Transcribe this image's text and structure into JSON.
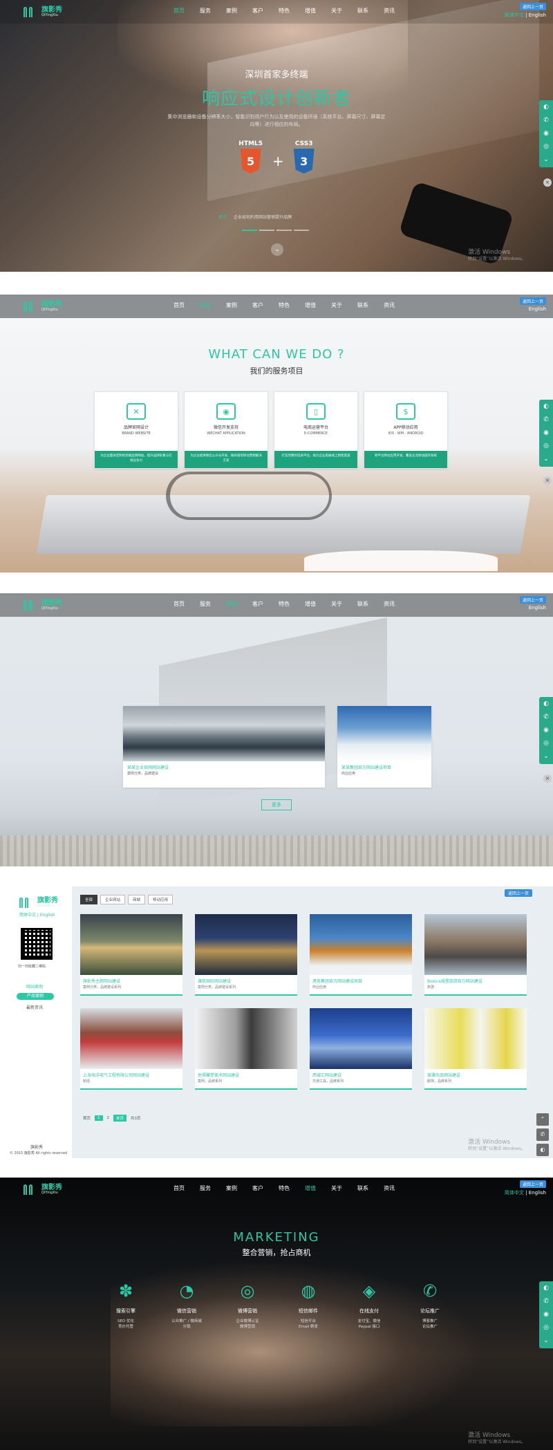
{
  "nav": {
    "logo_name": "旗影秀",
    "logo_sub": "QiYingXiu",
    "items": [
      "首页",
      "服务",
      "案例",
      "客户",
      "特色",
      "增值",
      "关于",
      "联系",
      "资讯"
    ],
    "lang_badge": "返回上一页",
    "lang_cn": "简体中文",
    "lang_sep": " | ",
    "lang_en": "English"
  },
  "hero": {
    "subtitle": "深圳首家多终端",
    "title": "响应式设计创新者",
    "desc": "集中浏览器和设备分辨率大小，智能识别用户行为以及使用的设备环境（系统平台、屏幕尺寸、屏幕定向等）进行相应的布局。",
    "html5_label": "HTML5",
    "css3_label": "CSS3",
    "html5_mark": "5",
    "css3_mark": "3",
    "plus": "+",
    "ticker_tag": "资讯",
    "ticker_text": "企业如何利用网站营销提升品牌"
  },
  "services": {
    "heading": "WHAT CAN WE DO ?",
    "subheading": "我们的服务项目",
    "items": [
      {
        "icon": "brand-icon",
        "glyph": "✕",
        "title": "品牌官网设计",
        "en": "BRAND WEBSITE",
        "foot": "为企业量身定制的高端品牌网站，提升品牌形象与在线竞争力"
      },
      {
        "icon": "wechat-icon",
        "glyph": "◉",
        "title": "微信开发支持",
        "en": "WECHAT APPLICATION",
        "foot": "为企业提供微信公众号开发、微商城等移动营销解决方案"
      },
      {
        "icon": "ecommerce-icon",
        "glyph": "▯",
        "title": "电商运营平台",
        "en": "E-COMMERCE",
        "foot": "打造完整的电商平台，助力企业拓展线上销售渠道"
      },
      {
        "icon": "app-icon",
        "glyph": "$",
        "title": "APP移动应用",
        "en": "IOS · WM · ANDROID",
        "foot": "跨平台移动应用开发，覆盖主流移动操作系统"
      }
    ]
  },
  "cases": {
    "left_cap": "某某企业官网网站建设",
    "left_sub": "案例分类，品牌建设",
    "right_cap": "某某集团官方网站建设项目",
    "right_sub": "商业应用",
    "more": "更多"
  },
  "portfolio": {
    "side_name": "旗影秀",
    "side_lang": "简体中文 | English",
    "qr_caption": "扫一扫收藏二维码",
    "links": [
      "网站案例",
      "产品案例",
      "最新资讯"
    ],
    "copyright": "© 2015 旗影秀 All rights reserved",
    "footer_name": "旗影秀",
    "top_badge": "返回上一页",
    "tabs": [
      "全部",
      "企业网站",
      "商城",
      "移动应用"
    ],
    "cards": [
      {
        "title": "旗影秀主题网站建设",
        "sub": "案例分类，品牌建设系列"
      },
      {
        "title": "渡航国际网站建设",
        "sub": "案例分类，品牌建设系列"
      },
      {
        "title": "港务集团官方网站建设项目",
        "sub": "商业应用"
      },
      {
        "title": "Boxica城堡旅游官方网站建设",
        "sub": "旅游"
      },
      {
        "title": "上海海洋电气工程有限公司网站建设",
        "sub": "制造"
      },
      {
        "title": "佐得雕塑美术网站建设",
        "sub": "案例，品牌系列"
      },
      {
        "title": "西城汇网站建设",
        "sub": "交通工具，品牌系列"
      },
      {
        "title": "莱雅尚品网站建设",
        "sub": "服饰，品牌系列"
      }
    ],
    "pager": [
      "首页",
      "1",
      "2",
      "末页"
    ],
    "pager_label": "共3页"
  },
  "marketing": {
    "heading": "MARKETING",
    "subheading": "整合营销，抢占商机",
    "items": [
      {
        "icon": "paw-icon",
        "glyph": "✽",
        "title": "搜索引擎",
        "sub": "SEO 优化\n竞价托管"
      },
      {
        "icon": "wechat-icon",
        "glyph": "◔",
        "title": "微信营销",
        "sub": "公众推广 / 微商城\n分销"
      },
      {
        "icon": "weibo-icon",
        "glyph": "◎",
        "title": "微博营销",
        "sub": "企业微博认证\n微博营销"
      },
      {
        "icon": "message-icon",
        "glyph": "◍",
        "title": "短信邮件",
        "sub": "短信平台\nEmail 群发"
      },
      {
        "icon": "shield-icon",
        "glyph": "◈",
        "title": "在线支付",
        "sub": "支付宝、微信\nPaypal 接口"
      },
      {
        "icon": "forum-icon",
        "glyph": "✆",
        "title": "论坛推广",
        "sub": "博客推广\n论坛推广"
      }
    ]
  },
  "watermark": {
    "title": "激活 Windows",
    "sub": "转到“设置”以激活 Windows。"
  },
  "colors": {
    "accent": "#2cc7a4",
    "service_footer": "#1fa37e",
    "float_bar": "#2aa98b",
    "lang_badge": "#3a8fd8"
  }
}
